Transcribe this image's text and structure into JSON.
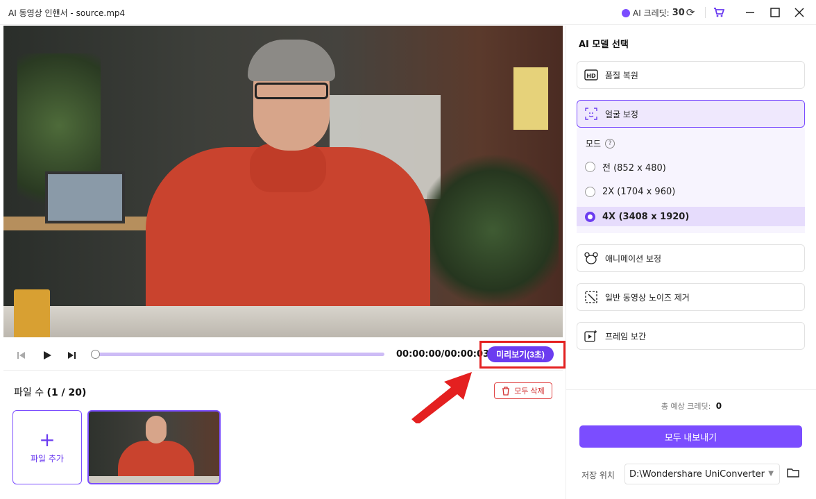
{
  "window": {
    "title": "AI 동영상 인핸서 - source.mp4",
    "credits_label": "AI 크레딧:",
    "credits_value": "30",
    "icons": [
      "refresh-icon",
      "cart-icon",
      "minimize-icon",
      "maximize-icon",
      "close-icon"
    ]
  },
  "player": {
    "time": "00:00:00/00:00:03",
    "preview_label": "미리보기(3초)",
    "progress": 0
  },
  "files": {
    "count_label": "파일 수",
    "count_value": "(1 / 20)",
    "delete_all": "모두 삭제",
    "add_file": "파일 추가"
  },
  "models": {
    "title": "AI 모델 선택",
    "items": [
      {
        "label": "품질 복원",
        "icon": "hd-icon",
        "selected": false
      },
      {
        "label": "얼굴 보정",
        "icon": "face-scan-icon",
        "selected": true
      },
      {
        "label": "애니메이션 보정",
        "icon": "bear-icon",
        "selected": false
      },
      {
        "label": "일반 동영상 노이즈 제거",
        "icon": "noise-remove-icon",
        "selected": false
      },
      {
        "label": "프레임 보간",
        "icon": "frame-interpolation-icon",
        "selected": false
      }
    ],
    "mode_label": "모드",
    "options": [
      {
        "label": "전 (852 x 480)",
        "selected": false
      },
      {
        "label": "2X (1704 x 960)",
        "selected": false
      },
      {
        "label": "4X (3408 x 1920)",
        "selected": true
      }
    ]
  },
  "footer": {
    "total_label": "총 예상 크레딧:",
    "total_value": "0",
    "export_all": "모두 내보내기",
    "save_label": "저장 위치",
    "save_path": "D:\\Wondershare UniConverter"
  },
  "colors": {
    "accent": "#7b4dff",
    "highlight_box": "#e42020"
  }
}
